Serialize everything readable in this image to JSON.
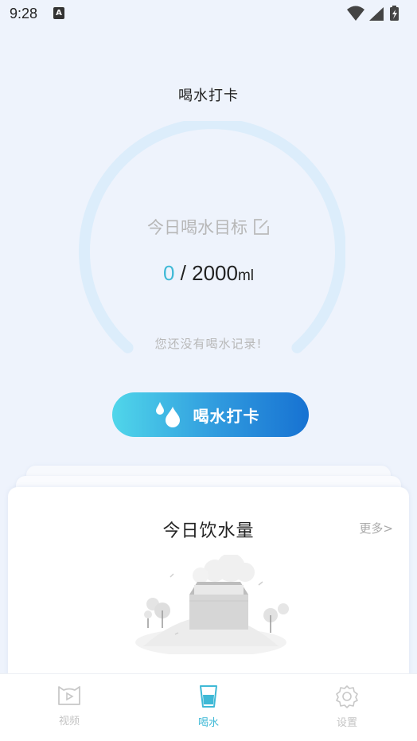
{
  "status_bar": {
    "time": "9:28",
    "notification_icon": "A",
    "icons": [
      "wifi-icon",
      "signal-icon",
      "battery-charging-icon"
    ]
  },
  "header": {
    "title": "喝水打卡"
  },
  "goal": {
    "label": "今日喝水目标",
    "current": "0",
    "separator": " / ",
    "target": "2000",
    "unit": "ml",
    "empty_text": "您还没有喝水记录!",
    "progress": 0
  },
  "checkin_button": {
    "label": "喝水打卡",
    "icon": "water-drops-icon"
  },
  "today_card": {
    "title": "今日饮水量",
    "more_label": "更多>",
    "illustration": "empty-box-illustration"
  },
  "bottom_nav": {
    "items": [
      {
        "label": "视频",
        "icon": "video-icon",
        "active": false
      },
      {
        "label": "喝水",
        "icon": "cup-icon",
        "active": true
      },
      {
        "label": "设置",
        "icon": "settings-icon",
        "active": false
      }
    ]
  },
  "colors": {
    "background": "#eef3fc",
    "accent": "#3fb9d6",
    "ring": "#dcedfb",
    "button_start": "#50d6ea",
    "button_end": "#1772d2"
  }
}
